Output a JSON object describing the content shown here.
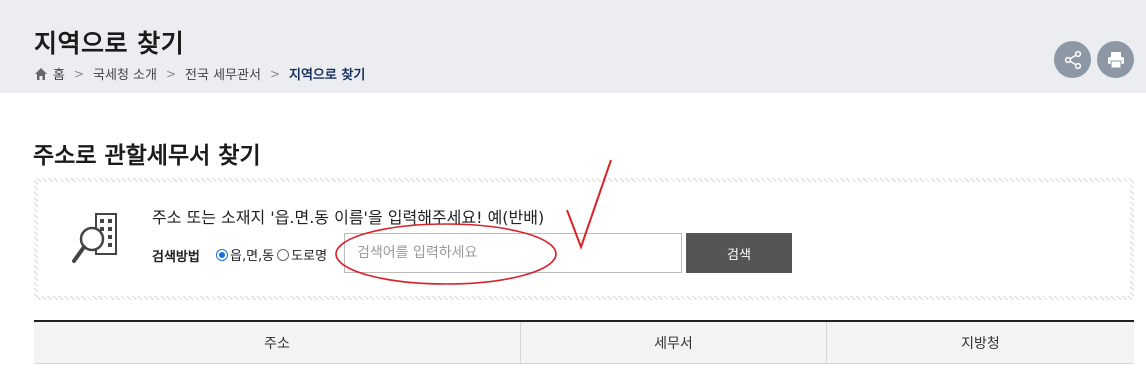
{
  "header": {
    "title": "지역으로 찾기",
    "breadcrumb": [
      "홈",
      "국세청 소개",
      "전국 세무관서",
      "지역으로 찾기"
    ]
  },
  "actions": {
    "share_icon": "share-icon",
    "print_icon": "print-icon"
  },
  "section": {
    "title": "주소로 관할세무서 찾기"
  },
  "search": {
    "instruction": "주소 또는 소재지 '읍.면.동 이름'을 입력해주세요! 예(반배)",
    "method_label": "검색방법",
    "methods": [
      {
        "label": "읍,면,동",
        "checked": true
      },
      {
        "label": "도로명",
        "checked": false
      }
    ],
    "placeholder": "검색어를 입력하세요",
    "value": "",
    "button_label": "검색"
  },
  "table": {
    "columns": [
      "주소",
      "세무서",
      "지방청"
    ]
  },
  "colors": {
    "header_bg": "#ecedf1",
    "accent": "#15305c",
    "button_bg": "#555555",
    "icon_circle": "#8e98a5",
    "annotation": "#d9232b"
  }
}
